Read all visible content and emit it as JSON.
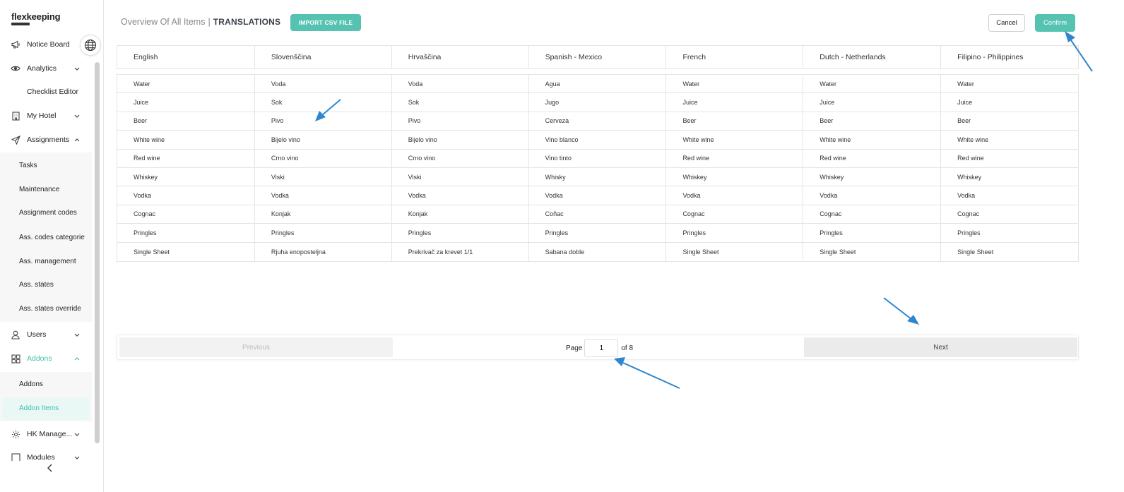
{
  "app": {
    "logo": "flexkeeping"
  },
  "sidebar": {
    "items": [
      {
        "label": "Notice Board",
        "icon": "megaphone-icon"
      },
      {
        "label": "Analytics",
        "icon": "eye-icon"
      },
      {
        "label": "Checklist Editor"
      },
      {
        "label": "My Hotel",
        "icon": "building-icon"
      },
      {
        "label": "Assignments",
        "icon": "paper-plane-icon"
      },
      {
        "label": "Users",
        "icon": "user-icon"
      },
      {
        "label": "Addons",
        "icon": "grid-icon"
      },
      {
        "label": "HK Manage...",
        "icon": "gear-icon"
      },
      {
        "label": "Modules",
        "icon": "modules-icon"
      }
    ],
    "assignments_sub": [
      "Tasks",
      "Maintenance",
      "Assignment codes",
      "Ass. codes categorie",
      "Ass. management",
      "Ass. states",
      "Ass. states override"
    ],
    "addons_sub": [
      "Addons",
      "Addon Items"
    ],
    "accent": "#3ebfab"
  },
  "header": {
    "breadcrumb_parent": "Overview Of All Items",
    "breadcrumb_sep": "|",
    "breadcrumb_current": "TRANSLATIONS",
    "import_label": "IMPORT CSV FILE",
    "cancel_label": "Cancel",
    "confirm_label": "Confirm"
  },
  "table": {
    "columns": [
      "English",
      "Slovenščina",
      "Hrvaščina",
      "Spanish - Mexico",
      "French",
      "Dutch - Netherlands",
      "Filipino - Philippines"
    ],
    "rows": [
      [
        "Water",
        "Voda",
        "Voda",
        "Agua",
        "Water",
        "Water",
        "Water"
      ],
      [
        "Juice",
        "Sok",
        "Sok",
        "Jugo",
        "Juice",
        "Juice",
        "Juice"
      ],
      [
        "Beer",
        "Pivo",
        "Pivo",
        "Cerveza",
        "Beer",
        "Beer",
        "Beer"
      ],
      [
        "White wine",
        "Bijelo vino",
        "Bijelo vino",
        "Vino blanco",
        "White wine",
        "White wine",
        "White wine"
      ],
      [
        "Red wine",
        "Crno vino",
        "Crno vino",
        "Vino tinto",
        "Red wine",
        "Red wine",
        "Red wine"
      ],
      [
        "Whiskey",
        "Viski",
        "Viski",
        "Whisky",
        "Whiskey",
        "Whiskey",
        "Whiskey"
      ],
      [
        "Vodka",
        "Vodka",
        "Vodka",
        "Vodka",
        "Vodka",
        "Vodka",
        "Vodka"
      ],
      [
        "Cognac",
        "Konjak",
        "Konjak",
        "Coñac",
        "Cognac",
        "Cognac",
        "Cognac"
      ],
      [
        "Pringles",
        "Pringles",
        "Pringles",
        "Pringles",
        "Pringles",
        "Pringles",
        "Pringles"
      ],
      [
        "Single Sheet",
        "Rjuha enoposteljna",
        "Prekrivač za krevet 1/1",
        "Sabana doble",
        "Single Sheet",
        "Single Sheet",
        "Single Sheet"
      ]
    ]
  },
  "pagination": {
    "previous_label": "Previous",
    "next_label": "Next",
    "page_label": "Page",
    "current_page": "1",
    "of_label": "of 8"
  },
  "annotation_color": "#2f86cf"
}
